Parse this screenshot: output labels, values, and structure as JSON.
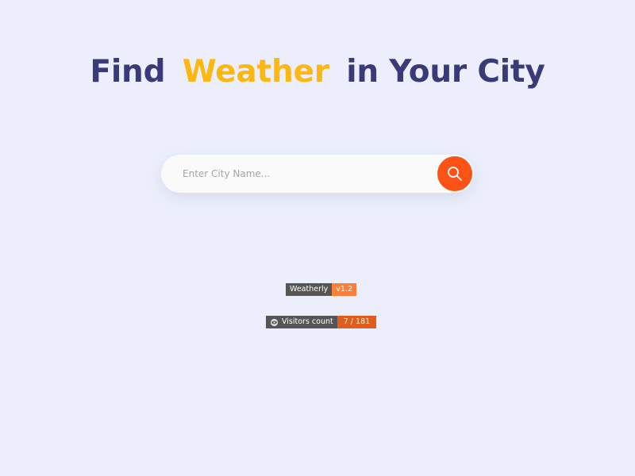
{
  "headline": {
    "part1": "Find",
    "accent": "Weather",
    "part2": "in Your City"
  },
  "search": {
    "placeholder": "Enter City Name...",
    "value": "",
    "button_icon": "search-icon"
  },
  "badges": {
    "version": {
      "label": "Weatherly",
      "value": "v1.2",
      "color": "#fe7d37"
    },
    "visitors": {
      "icon": "eye-icon",
      "label": "Visitors count",
      "value": "7 / 181",
      "color": "#e05d1e"
    }
  },
  "colors": {
    "background": "#eceffb",
    "headline": "#393a78",
    "accent": "#fcb711",
    "search_button": "#fb5315"
  }
}
